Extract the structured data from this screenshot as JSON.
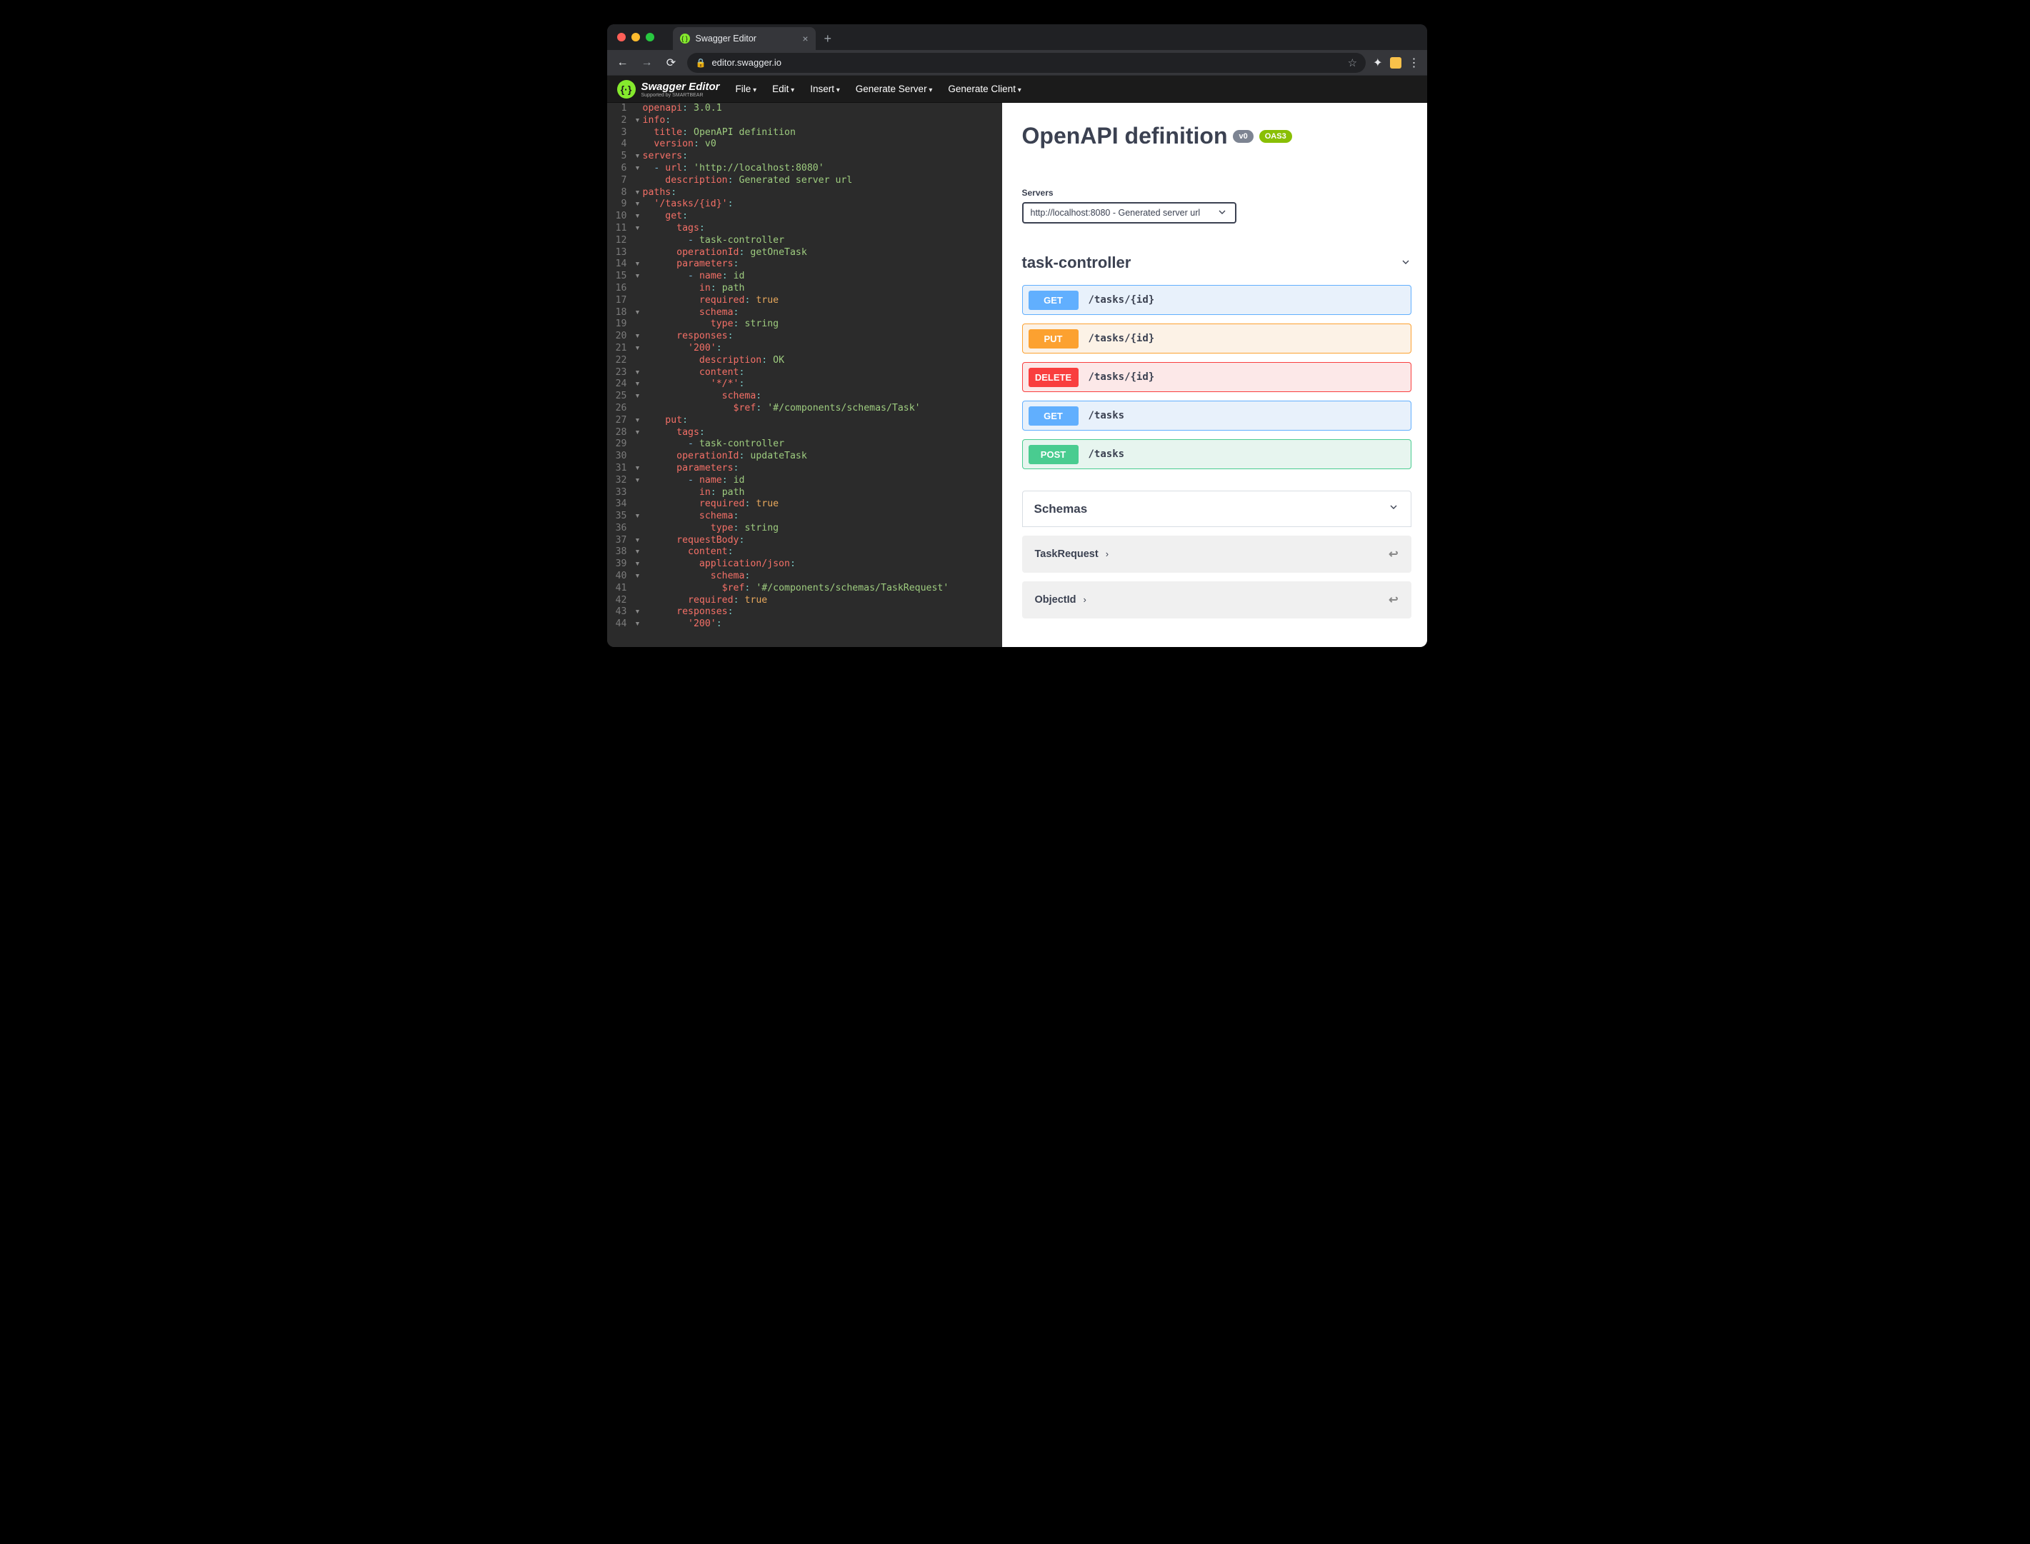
{
  "browser": {
    "tab_title": "Swagger Editor",
    "url_display": "editor.swagger.io",
    "new_tab_glyph": "+"
  },
  "app": {
    "brand": "Swagger Editor",
    "brand_sub": "Supported by SMARTBEAR",
    "menu": [
      "File",
      "Edit",
      "Insert",
      "Generate Server",
      "Generate Client"
    ]
  },
  "editor": {
    "lines": [
      {
        "n": 1,
        "fold": "",
        "html": "<span class='k-red'>openapi</span><span class='k-teal'>:</span> <span class='k-green'>3.0.1</span>"
      },
      {
        "n": 2,
        "fold": "▾",
        "html": "<span class='k-red'>info</span><span class='k-teal'>:</span>"
      },
      {
        "n": 3,
        "fold": "",
        "html": "  <span class='k-red'>title</span><span class='k-teal'>:</span> <span class='k-green'>OpenAPI definition</span>"
      },
      {
        "n": 4,
        "fold": "",
        "html": "  <span class='k-red'>version</span><span class='k-teal'>:</span> <span class='k-green'>v0</span>"
      },
      {
        "n": 5,
        "fold": "▾",
        "html": "<span class='k-red'>servers</span><span class='k-teal'>:</span>"
      },
      {
        "n": 6,
        "fold": "▾",
        "html": "  <span class='k-blue'>-</span> <span class='k-red'>url</span><span class='k-teal'>:</span> <span class='k-green'>'http://localhost:8080'</span>"
      },
      {
        "n": 7,
        "fold": "",
        "html": "    <span class='k-red'>description</span><span class='k-teal'>:</span> <span class='k-green'>Generated server url</span>"
      },
      {
        "n": 8,
        "fold": "▾",
        "html": "<span class='k-red'>paths</span><span class='k-teal'>:</span>"
      },
      {
        "n": 9,
        "fold": "▾",
        "html": "  <span class='k-red'>'/tasks/{id}'</span><span class='k-teal'>:</span>"
      },
      {
        "n": 10,
        "fold": "▾",
        "html": "    <span class='k-red'>get</span><span class='k-teal'>:</span>"
      },
      {
        "n": 11,
        "fold": "▾",
        "html": "      <span class='k-red'>tags</span><span class='k-teal'>:</span>"
      },
      {
        "n": 12,
        "fold": "",
        "html": "        <span class='k-blue'>-</span> <span class='k-green'>task-controller</span>"
      },
      {
        "n": 13,
        "fold": "",
        "html": "      <span class='k-red'>operationId</span><span class='k-teal'>:</span> <span class='k-green'>getOneTask</span>"
      },
      {
        "n": 14,
        "fold": "▾",
        "html": "      <span class='k-red'>parameters</span><span class='k-teal'>:</span>"
      },
      {
        "n": 15,
        "fold": "▾",
        "html": "        <span class='k-blue'>-</span> <span class='k-red'>name</span><span class='k-teal'>:</span> <span class='k-green'>id</span>"
      },
      {
        "n": 16,
        "fold": "",
        "html": "          <span class='k-red'>in</span><span class='k-teal'>:</span> <span class='k-green'>path</span>"
      },
      {
        "n": 17,
        "fold": "",
        "html": "          <span class='k-red'>required</span><span class='k-teal'>:</span> <span class='k-orange'>true</span>"
      },
      {
        "n": 18,
        "fold": "▾",
        "html": "          <span class='k-red'>schema</span><span class='k-teal'>:</span>"
      },
      {
        "n": 19,
        "fold": "",
        "html": "            <span class='k-red'>type</span><span class='k-teal'>:</span> <span class='k-green'>string</span>"
      },
      {
        "n": 20,
        "fold": "▾",
        "html": "      <span class='k-red'>responses</span><span class='k-teal'>:</span>"
      },
      {
        "n": 21,
        "fold": "▾",
        "html": "        <span class='k-red'>'200'</span><span class='k-teal'>:</span>"
      },
      {
        "n": 22,
        "fold": "",
        "html": "          <span class='k-red'>description</span><span class='k-teal'>:</span> <span class='k-green'>OK</span>"
      },
      {
        "n": 23,
        "fold": "▾",
        "html": "          <span class='k-red'>content</span><span class='k-teal'>:</span>"
      },
      {
        "n": 24,
        "fold": "▾",
        "html": "            <span class='k-red'>'*/*'</span><span class='k-teal'>:</span>"
      },
      {
        "n": 25,
        "fold": "▾",
        "html": "              <span class='k-red'>schema</span><span class='k-teal'>:</span>"
      },
      {
        "n": 26,
        "fold": "",
        "html": "                <span class='k-red'>$ref</span><span class='k-teal'>:</span> <span class='k-green'>'#/components/schemas/Task'</span>"
      },
      {
        "n": 27,
        "fold": "▾",
        "html": "    <span class='k-red'>put</span><span class='k-teal'>:</span>"
      },
      {
        "n": 28,
        "fold": "▾",
        "html": "      <span class='k-red'>tags</span><span class='k-teal'>:</span>"
      },
      {
        "n": 29,
        "fold": "",
        "html": "        <span class='k-blue'>-</span> <span class='k-green'>task-controller</span>"
      },
      {
        "n": 30,
        "fold": "",
        "html": "      <span class='k-red'>operationId</span><span class='k-teal'>:</span> <span class='k-green'>updateTask</span>"
      },
      {
        "n": 31,
        "fold": "▾",
        "html": "      <span class='k-red'>parameters</span><span class='k-teal'>:</span>"
      },
      {
        "n": 32,
        "fold": "▾",
        "html": "        <span class='k-blue'>-</span> <span class='k-red'>name</span><span class='k-teal'>:</span> <span class='k-green'>id</span>"
      },
      {
        "n": 33,
        "fold": "",
        "html": "          <span class='k-red'>in</span><span class='k-teal'>:</span> <span class='k-green'>path</span>"
      },
      {
        "n": 34,
        "fold": "",
        "html": "          <span class='k-red'>required</span><span class='k-teal'>:</span> <span class='k-orange'>true</span>"
      },
      {
        "n": 35,
        "fold": "▾",
        "html": "          <span class='k-red'>schema</span><span class='k-teal'>:</span>"
      },
      {
        "n": 36,
        "fold": "",
        "html": "            <span class='k-red'>type</span><span class='k-teal'>:</span> <span class='k-green'>string</span>"
      },
      {
        "n": 37,
        "fold": "▾",
        "html": "      <span class='k-red'>requestBody</span><span class='k-teal'>:</span>"
      },
      {
        "n": 38,
        "fold": "▾",
        "html": "        <span class='k-red'>content</span><span class='k-teal'>:</span>"
      },
      {
        "n": 39,
        "fold": "▾",
        "html": "          <span class='k-red'>application/json</span><span class='k-teal'>:</span>"
      },
      {
        "n": 40,
        "fold": "▾",
        "html": "            <span class='k-red'>schema</span><span class='k-teal'>:</span>"
      },
      {
        "n": 41,
        "fold": "",
        "html": "              <span class='k-red'>$ref</span><span class='k-teal'>:</span> <span class='k-green'>'#/components/schemas/TaskRequest'</span>"
      },
      {
        "n": 42,
        "fold": "",
        "html": "        <span class='k-red'>required</span><span class='k-teal'>:</span> <span class='k-orange'>true</span>"
      },
      {
        "n": 43,
        "fold": "▾",
        "html": "      <span class='k-red'>responses</span><span class='k-teal'>:</span>"
      },
      {
        "n": 44,
        "fold": "▾",
        "html": "        <span class='k-red'>'200'</span><span class='k-teal'>:</span>"
      }
    ]
  },
  "preview": {
    "title": "OpenAPI definition",
    "version_badge": "v0",
    "oas_badge": "OAS3",
    "servers_label": "Servers",
    "servers_selected": "http://localhost:8080 - Generated server url",
    "tag": "task-controller",
    "ops": [
      {
        "verb": "GET",
        "path": "/tasks/{id}",
        "cls": "get"
      },
      {
        "verb": "PUT",
        "path": "/tasks/{id}",
        "cls": "put"
      },
      {
        "verb": "DELETE",
        "path": "/tasks/{id}",
        "cls": "delete"
      },
      {
        "verb": "GET",
        "path": "/tasks",
        "cls": "get"
      },
      {
        "verb": "POST",
        "path": "/tasks",
        "cls": "post"
      }
    ],
    "schemas_label": "Schemas",
    "schemas": [
      "TaskRequest",
      "ObjectId"
    ]
  }
}
